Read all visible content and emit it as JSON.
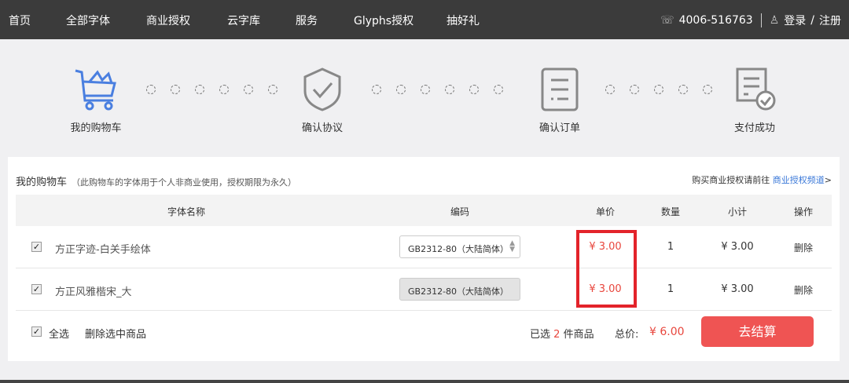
{
  "nav": {
    "items": [
      "首页",
      "全部字体",
      "商业授权",
      "云字库",
      "服务",
      "Glyphs授权",
      "抽好礼"
    ],
    "phone": "4006-516763",
    "login": "登录",
    "slash": "/",
    "register": "注册"
  },
  "steps": [
    "我的购物车",
    "确认协议",
    "确认订单",
    "支付成功"
  ],
  "cart": {
    "title": "我的购物车",
    "note": "（此购物车的字体用于个人非商业使用，授权期限为永久）",
    "link_prefix": "购买商业授权请前往",
    "link": "商业授权频道",
    "link_suffix": ">",
    "headers": [
      "字体名称",
      "编码",
      "单价",
      "数量",
      "小计",
      "操作"
    ],
    "rows": [
      {
        "name": "方正字迹-白关手绘体",
        "encoding": "GB2312-80（大陆简体）",
        "price": "¥ 3.00",
        "qty": "1",
        "subtotal": "¥ 3.00",
        "action": "删除"
      },
      {
        "name": "方正风雅楷宋_大",
        "encoding": "GB2312-80（大陆简体）",
        "price": "¥ 3.00",
        "qty": "1",
        "subtotal": "¥ 3.00",
        "action": "删除"
      }
    ],
    "footer": {
      "select_all": "全选",
      "delete_selected": "删除选中商品",
      "selected_prefix": "已选",
      "selected_count": "2",
      "selected_suffix": "件商品",
      "total_label": "总价:",
      "total": "¥ 6.00",
      "checkout": "去结算"
    }
  },
  "colors": {
    "accent": "#ef5453",
    "link": "#3a78d8",
    "step_active": "#4a7fe0"
  }
}
